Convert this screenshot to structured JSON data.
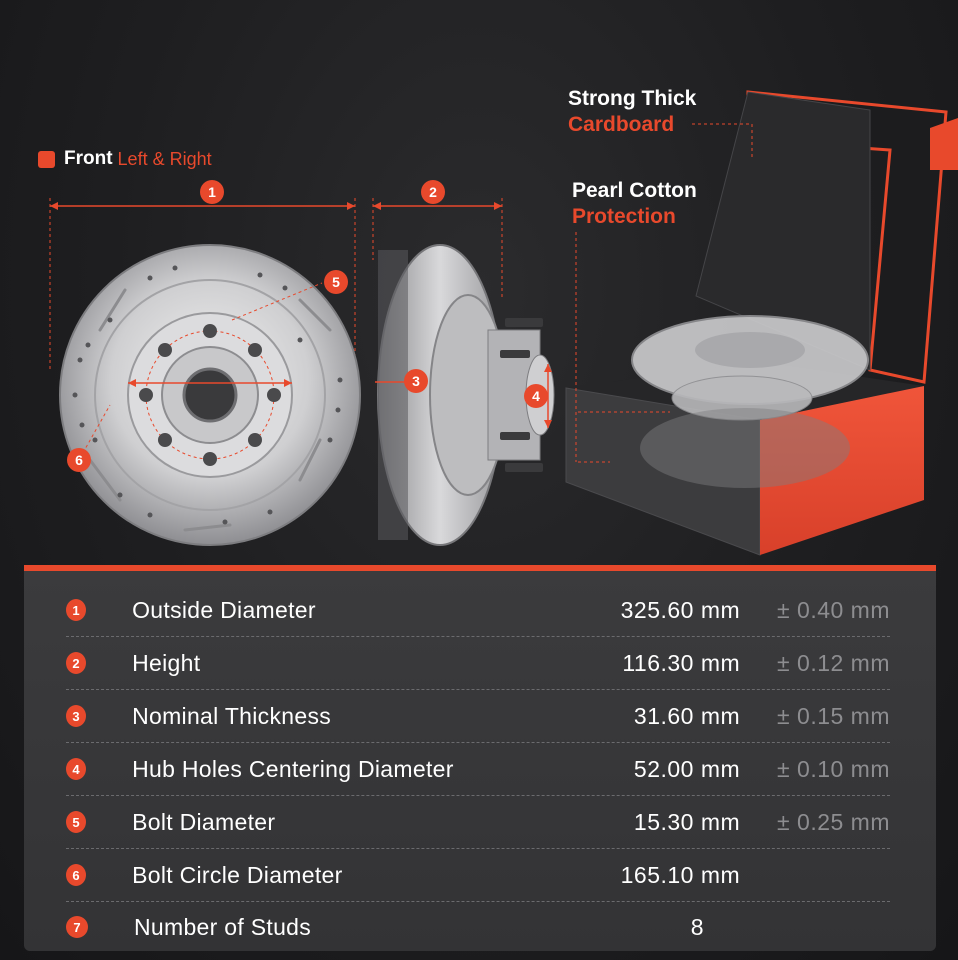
{
  "legend": {
    "strong": "Front",
    "accent": "Left & Right"
  },
  "callouts": [
    {
      "line1": "Strong Thick",
      "line2": "Cardboard"
    },
    {
      "line1": "Pearl Cotton",
      "line2": "Protection"
    }
  ],
  "markers": [
    "1",
    "2",
    "3",
    "4",
    "5",
    "6"
  ],
  "colors": {
    "accent": "#e8492c",
    "panel": "#3b3b3d",
    "background": "#1e1e20",
    "tolerance": "#8d8d90"
  },
  "specs": [
    {
      "num": "1",
      "name": "Outside Diameter",
      "value": "325.60 mm",
      "tolerance": "± 0.40 mm"
    },
    {
      "num": "2",
      "name": "Height",
      "value": "116.30 mm",
      "tolerance": "± 0.12 mm"
    },
    {
      "num": "3",
      "name": "Nominal Thickness",
      "value": "31.60 mm",
      "tolerance": "± 0.15 mm"
    },
    {
      "num": "4",
      "name": "Hub Holes Centering Diameter",
      "value": "52.00 mm",
      "tolerance": "± 0.10 mm"
    },
    {
      "num": "5",
      "name": "Bolt Diameter",
      "value": "15.30 mm",
      "tolerance": "± 0.25 mm"
    },
    {
      "num": "6",
      "name": "Bolt Circle Diameter",
      "value": "165.10 mm",
      "tolerance": ""
    },
    {
      "num": "7",
      "name": "Number of Studs",
      "value": "8",
      "tolerance": ""
    }
  ]
}
